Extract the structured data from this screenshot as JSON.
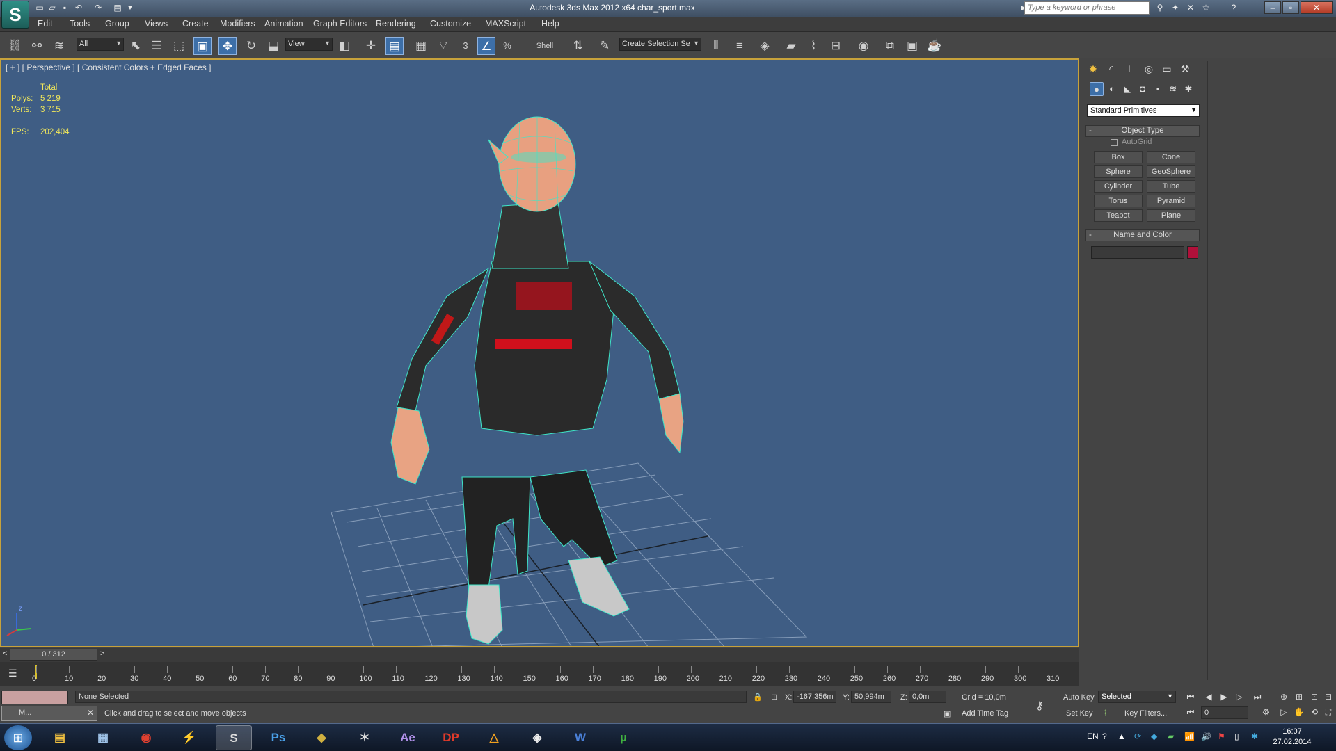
{
  "titlebar": {
    "title": "Autodesk 3ds Max  2012 x64      char_sport.max",
    "search_placeholder": "Type a keyword or phrase",
    "app_logo": "3ds-max-logo",
    "quick_access": [
      "new-file-icon",
      "open-file-icon",
      "save-icon",
      "undo-icon",
      "redo-icon",
      "project-folder-icon"
    ],
    "window_buttons": [
      "minimize",
      "restore",
      "close"
    ]
  },
  "menu": [
    "Edit",
    "Tools",
    "Group",
    "Views",
    "Create",
    "Modifiers",
    "Animation",
    "Graph Editors",
    "Rendering",
    "Customize",
    "MAXScript",
    "Help"
  ],
  "toolbar": {
    "selection_filter": "All",
    "ref_coord": "View",
    "snap_label": "3",
    "angle_snap_label": "%",
    "shell_label": "Shell",
    "named_selection": "Create Selection Se"
  },
  "viewport": {
    "label": "[ + ] [ Perspective ] [ Consistent Colors + Edged Faces ]",
    "stats_header": "Total",
    "polys_label": "Polys:",
    "polys_value": "5 219",
    "verts_label": "Verts:",
    "verts_value": "3 715",
    "fps_label": "FPS:",
    "fps_value": "202,404",
    "axis_label": "z"
  },
  "command_panel": {
    "tabs": [
      "create-tab",
      "modify-tab",
      "hierarchy-tab",
      "motion-tab",
      "display-tab",
      "utilities-tab"
    ],
    "category": "Standard Primitives",
    "object_type_title": "Object Type",
    "autogrid_label": "AutoGrid",
    "primitives": [
      "Box",
      "Cone",
      "Sphere",
      "GeoSphere",
      "Cylinder",
      "Tube",
      "Torus",
      "Pyramid",
      "Teapot",
      "Plane"
    ],
    "name_color_title": "Name and Color",
    "object_color": "#b0103a"
  },
  "timeline": {
    "frame_display": "0 / 312",
    "ticks": [
      "0",
      "10",
      "20",
      "30",
      "40",
      "50",
      "60",
      "70",
      "80",
      "90",
      "100",
      "110",
      "120",
      "130",
      "140",
      "150",
      "160",
      "170",
      "180",
      "190",
      "200",
      "210",
      "220",
      "230",
      "240",
      "250",
      "260",
      "270",
      "280",
      "290",
      "300",
      "310"
    ],
    "prev_arrow": "<",
    "next_arrow": ">"
  },
  "status": {
    "script_label": "M...",
    "selection_status": "None Selected",
    "prompt": "Click and drag to select and move objects",
    "x_label": "X:",
    "x_value": "-167,356m",
    "y_label": "Y:",
    "y_value": "50,994m",
    "z_label": "Z:",
    "z_value": "0,0m",
    "grid": "Grid = 10,0m",
    "add_time_tag": "Add Time Tag",
    "auto_key": "Auto Key",
    "key_mode": "Selected",
    "set_key": "Set Key",
    "key_filters": "Key Filters...",
    "current_frame": "0"
  },
  "taskbar": {
    "apps": [
      "Windows Explorer",
      "Calculator",
      "Chrome",
      "Winamp",
      "3ds Max",
      "Photoshop",
      "Keyshot",
      "Motion",
      "After Effects",
      "DP",
      "Autodesk",
      "Unity",
      "Word",
      "uTorrent"
    ],
    "lang": "EN",
    "time": "16:07",
    "date": "27.02.2014"
  }
}
